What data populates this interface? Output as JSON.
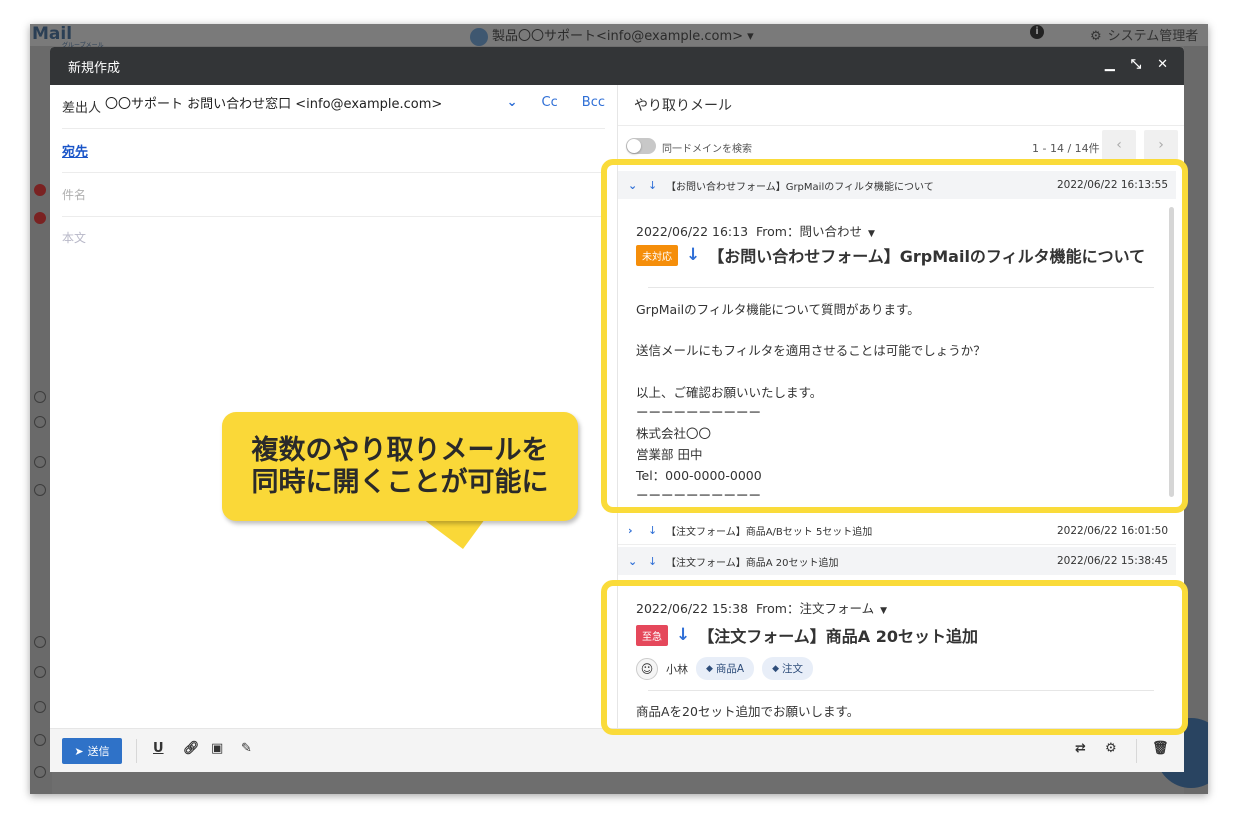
{
  "backdrop": {
    "logo": "Mail",
    "logo_sub": "グループメール",
    "account": "製品〇〇サポート<info@example.com> ▾",
    "info_icon": "info-icon",
    "admin": "システム管理者"
  },
  "modal": {
    "title": "新規作成",
    "controls": [
      "minimize-icon",
      "collapse-icon",
      "close-icon"
    ]
  },
  "compose": {
    "from_label": "差出人",
    "from_value": "〇〇サポート お問い合わせ窓口 <info@example.com>",
    "cc": "Cc",
    "bcc": "Bcc",
    "to_label": "宛先",
    "subject_placeholder": "件名",
    "body_placeholder": "本文"
  },
  "thread": {
    "title": "やり取りメール",
    "toggle_label": "同一ドメインを検索",
    "pager": "1 - 14 / 14件",
    "mails": [
      {
        "subject": "【お問い合わせフォーム】GrpMailのフィルタ機能について",
        "date": "2022/06/22 16:13:55",
        "expanded": true
      },
      {
        "subject": "【注文フォーム】商品A/Bセット 5セット追加",
        "date": "2022/06/22 16:01:50",
        "expanded": false
      },
      {
        "subject": "【注文フォーム】商品A 20セット追加",
        "date": "2022/06/22 15:38:45",
        "expanded": true
      }
    ],
    "card1": {
      "meta": "2022/06/22 16:13",
      "from": "From：問い合わせ",
      "badge": "未対応",
      "badge_color": "#f58e0a",
      "subject": "【お問い合わせフォーム】GrpMailのフィルタ機能について",
      "body": [
        "GrpMailのフィルタ機能について質問があります。",
        "",
        "送信メールにもフィルタを適用させることは可能でしょうか？",
        "",
        "以上、ご確認お願いいたします。",
        "ーーーーーーーーーー",
        "株式会社〇〇",
        "営業部 田中",
        "Tel：000-0000-0000",
        "ーーーーーーーーーー"
      ]
    },
    "card2": {
      "meta": "2022/06/22 15:38",
      "from": "From：注文フォーム",
      "badge": "至急",
      "badge_color": "#e5485b",
      "subject": "【注文フォーム】商品A 20セット追加",
      "assignee": "小林",
      "tags": [
        "商品A",
        "注文"
      ],
      "body": "商品Aを20セット追加でお願いします。"
    }
  },
  "footer": {
    "send": "送信"
  },
  "callout": {
    "line1": "複数のやり取りメールを",
    "line2": "同時に開くことが可能に"
  },
  "colors": {
    "highlight": "#fadb3a",
    "accent": "#2f6fd6"
  }
}
